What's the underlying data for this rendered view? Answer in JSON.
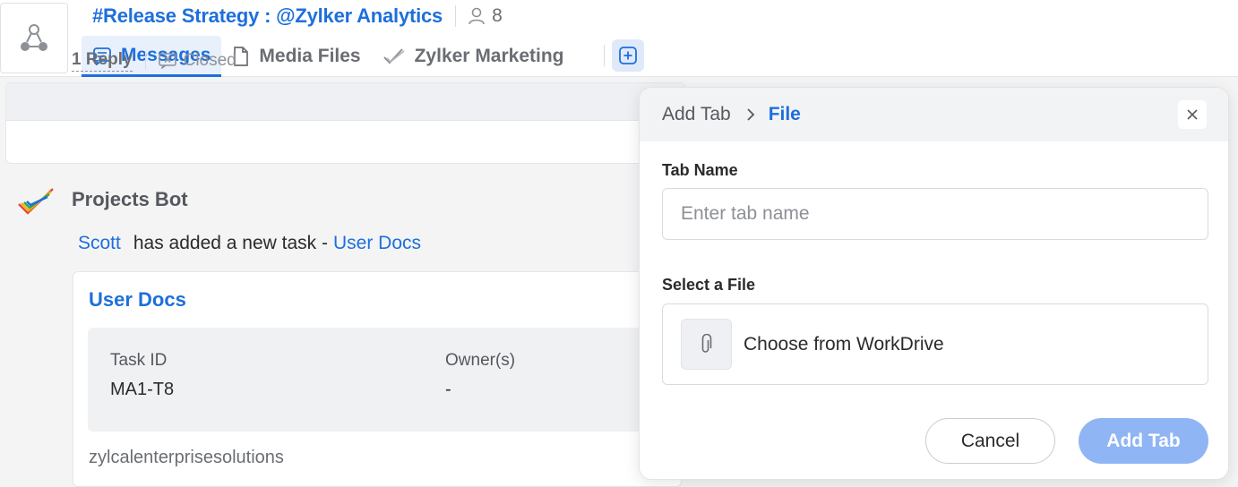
{
  "header": {
    "channel_title": "#Release Strategy : @Zylker Analytics",
    "member_count": "8",
    "avatar_icon": "channel-network-icon",
    "tabs": [
      {
        "label": "Messages",
        "icon": "message-icon",
        "active": true
      },
      {
        "label": "Media Files",
        "icon": "file-icon",
        "active": false
      },
      {
        "label": "Zylker Marketing",
        "icon": "projects-check-icon",
        "active": false
      }
    ],
    "add_tab_icon": "plus-square-icon"
  },
  "thread": {
    "reply_label": "1 Reply",
    "status_label": "Closed"
  },
  "bot_message": {
    "sender": "Projects Bot",
    "actor": "Scott",
    "action_text": "has added a new task -",
    "task_link": "User Docs",
    "card": {
      "title": "User Docs",
      "fields": [
        {
          "label": "Task ID",
          "value": "MA1-T8"
        },
        {
          "label": "Owner(s)",
          "value": "-"
        }
      ],
      "portal": "zylcalenterprisesolutions"
    }
  },
  "popover": {
    "breadcrumb_root": "Add Tab",
    "breadcrumb_current": "File",
    "tab_name_label": "Tab Name",
    "tab_name_placeholder": "Enter tab name",
    "tab_name_value": "",
    "select_file_label": "Select a File",
    "choose_file_label": "Choose from WorkDrive",
    "cancel_label": "Cancel",
    "add_label": "Add Tab"
  },
  "colors": {
    "accent": "#1d6fdc",
    "add_button_disabled": "#8fb5f4",
    "background": "#f4f4f5"
  }
}
